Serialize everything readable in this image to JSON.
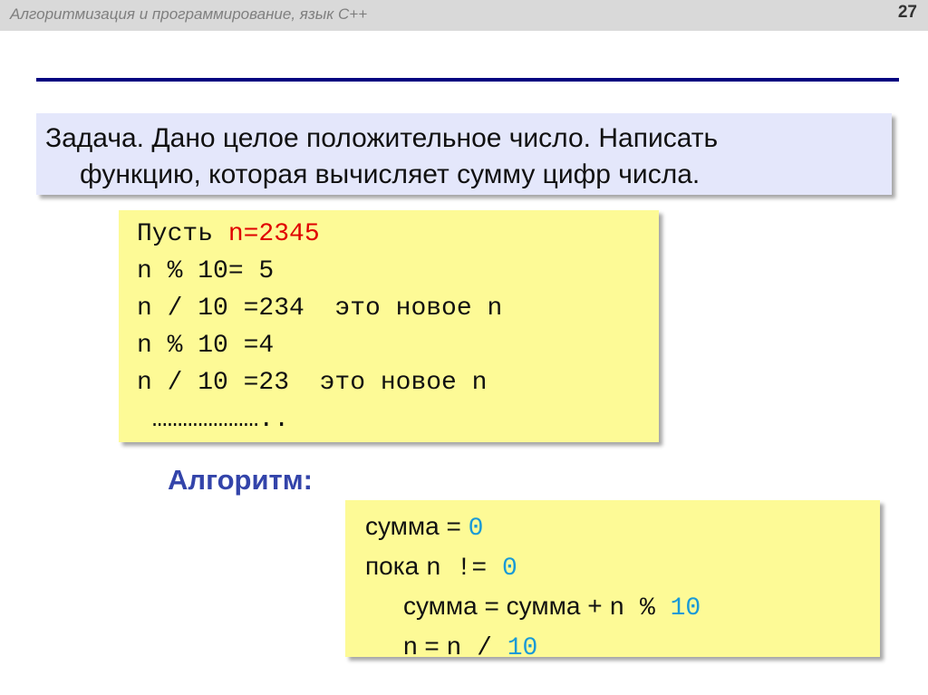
{
  "header": {
    "title": "Алгоритмизация и программирование, язык С++",
    "page_number": "27"
  },
  "task": {
    "line1": "Задача. Дано целое  положительное число.  Написать",
    "line2": "функцию, которая вычисляет сумму цифр числа."
  },
  "example": {
    "l1_prefix": "Пусть ",
    "l1_value": "n=2345",
    "l2": "n % 10= 5",
    "l3": "n / 10 =234  это новое n",
    "l4": "n % 10 =4",
    "l5": "n / 10 =23  это новое n",
    "l6": " ………………….."
  },
  "algorithm": {
    "title": "Алгоритм:",
    "l1_text": "сумма = ",
    "l1_num": "0",
    "l2_text": "пока ",
    "l2_code": "n != ",
    "l2_num": "0",
    "l3_text": "сумма = сумма + ",
    "l3_code": "n % ",
    "l3_num": "10",
    "l4_text": "n = ",
    "l4_code": "n / ",
    "l4_num": "10"
  },
  "colors": {
    "header_bg": "#d9d9d9",
    "rule": "#000080",
    "task_bg": "#e4e7fb",
    "code_bg": "#fdfa96",
    "highlight_red": "#e00000",
    "number_blue": "#1a9ad6",
    "algo_title": "#3344aa"
  }
}
